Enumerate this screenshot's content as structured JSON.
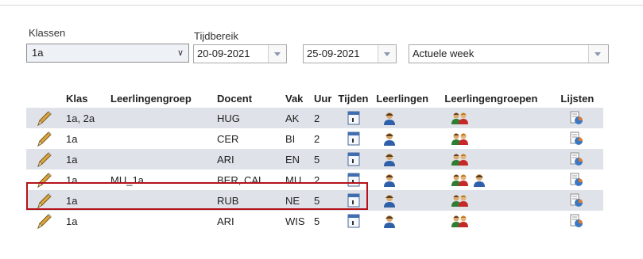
{
  "filters": {
    "class_label": "Klassen",
    "class_value": "1a",
    "period_label": "Tijdbereik",
    "date_from": "20-09-2021",
    "date_to": "25-09-2021",
    "range_value": "Actuele week"
  },
  "table": {
    "headers": [
      "Klas",
      "Leerlingengroep",
      "Docent",
      "Vak",
      "Uur",
      "Tijden",
      "Leerlingen",
      "Leerlingengroepen",
      "Lijsten"
    ],
    "rows": [
      {
        "klas": "1a, 2a",
        "group": "",
        "docent": "HUG",
        "vak": "AK",
        "uur": "2",
        "extra_student": false
      },
      {
        "klas": "1a",
        "group": "",
        "docent": "CER",
        "vak": "BI",
        "uur": "2",
        "extra_student": false
      },
      {
        "klas": "1a",
        "group": "",
        "docent": "ARI",
        "vak": "EN",
        "uur": "5",
        "extra_student": false
      },
      {
        "klas": "1a",
        "group": "MU_1a",
        "docent": "BER, CAL",
        "vak": "MU",
        "uur": "2",
        "extra_student": true
      },
      {
        "klas": "1a",
        "group": "",
        "docent": "RUB",
        "vak": "NE",
        "uur": "5",
        "extra_student": false
      },
      {
        "klas": "1a",
        "group": "",
        "docent": "ARI",
        "vak": "WIS",
        "uur": "5",
        "extra_student": false
      }
    ]
  },
  "icons": {
    "edit": "pencil-icon",
    "times": "calendar-icon",
    "students": "student-icon",
    "groups": "student-group-icon",
    "lists": "list-chart-icon"
  },
  "colors": {
    "highlight_border": "#b5121b",
    "alt_row": "#dfe3e9"
  }
}
